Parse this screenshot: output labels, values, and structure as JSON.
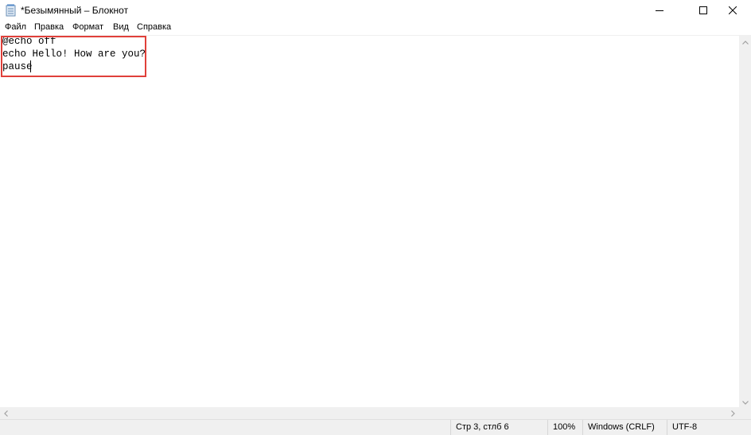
{
  "window": {
    "title": "*Безымянный – Блокнот",
    "icon": "notepad-icon",
    "controls": [
      "minimize-icon",
      "maximize-icon",
      "close-icon"
    ]
  },
  "menu": {
    "items": [
      "Файл",
      "Правка",
      "Формат",
      "Вид",
      "Справка"
    ]
  },
  "editor": {
    "lines": [
      "@echo off",
      "echo Hello! How are you?",
      "pause"
    ],
    "highlight_color": "#e0403a"
  },
  "status": {
    "position": "Стр 3, стлб 6",
    "zoom": "100%",
    "line_endings": "Windows (CRLF)",
    "encoding": "UTF-8"
  }
}
